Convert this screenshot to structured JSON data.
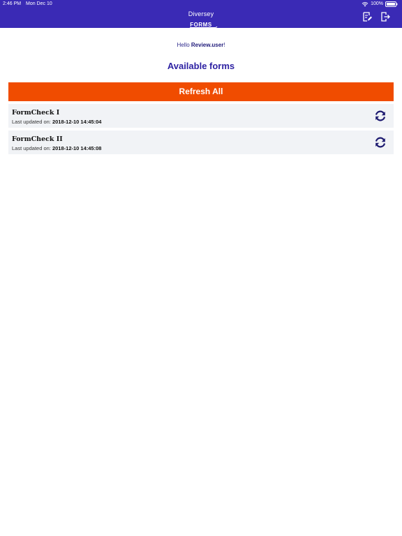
{
  "status_bar": {
    "time": "2:46 PM",
    "date": "Mon Dec 10",
    "battery": "100%"
  },
  "header": {
    "logo_top": "Diversey",
    "logo_bottom": "FORMS",
    "icons": {
      "edit": "edit-form-icon",
      "logout": "logout-icon"
    }
  },
  "greeting": {
    "prefix": "Hello ",
    "username": "Review.user",
    "suffix": "!"
  },
  "title": "Available forms",
  "refresh_all_label": "Refresh All",
  "forms": [
    {
      "name": "FormCheck I",
      "updated_label": "Last updated on: ",
      "updated_value": "2018-12-10 14:45:04"
    },
    {
      "name": "FormCheck II",
      "updated_label": "Last updated on: ",
      "updated_value": "2018-12-10 14:45:08"
    }
  ],
  "colors": {
    "header_bg": "#3a2ab5",
    "accent_orange": "#f04c00",
    "title_blue": "#2e22a3",
    "row_bg": "#f1f3f6",
    "icon_navy": "#1d1a70"
  }
}
